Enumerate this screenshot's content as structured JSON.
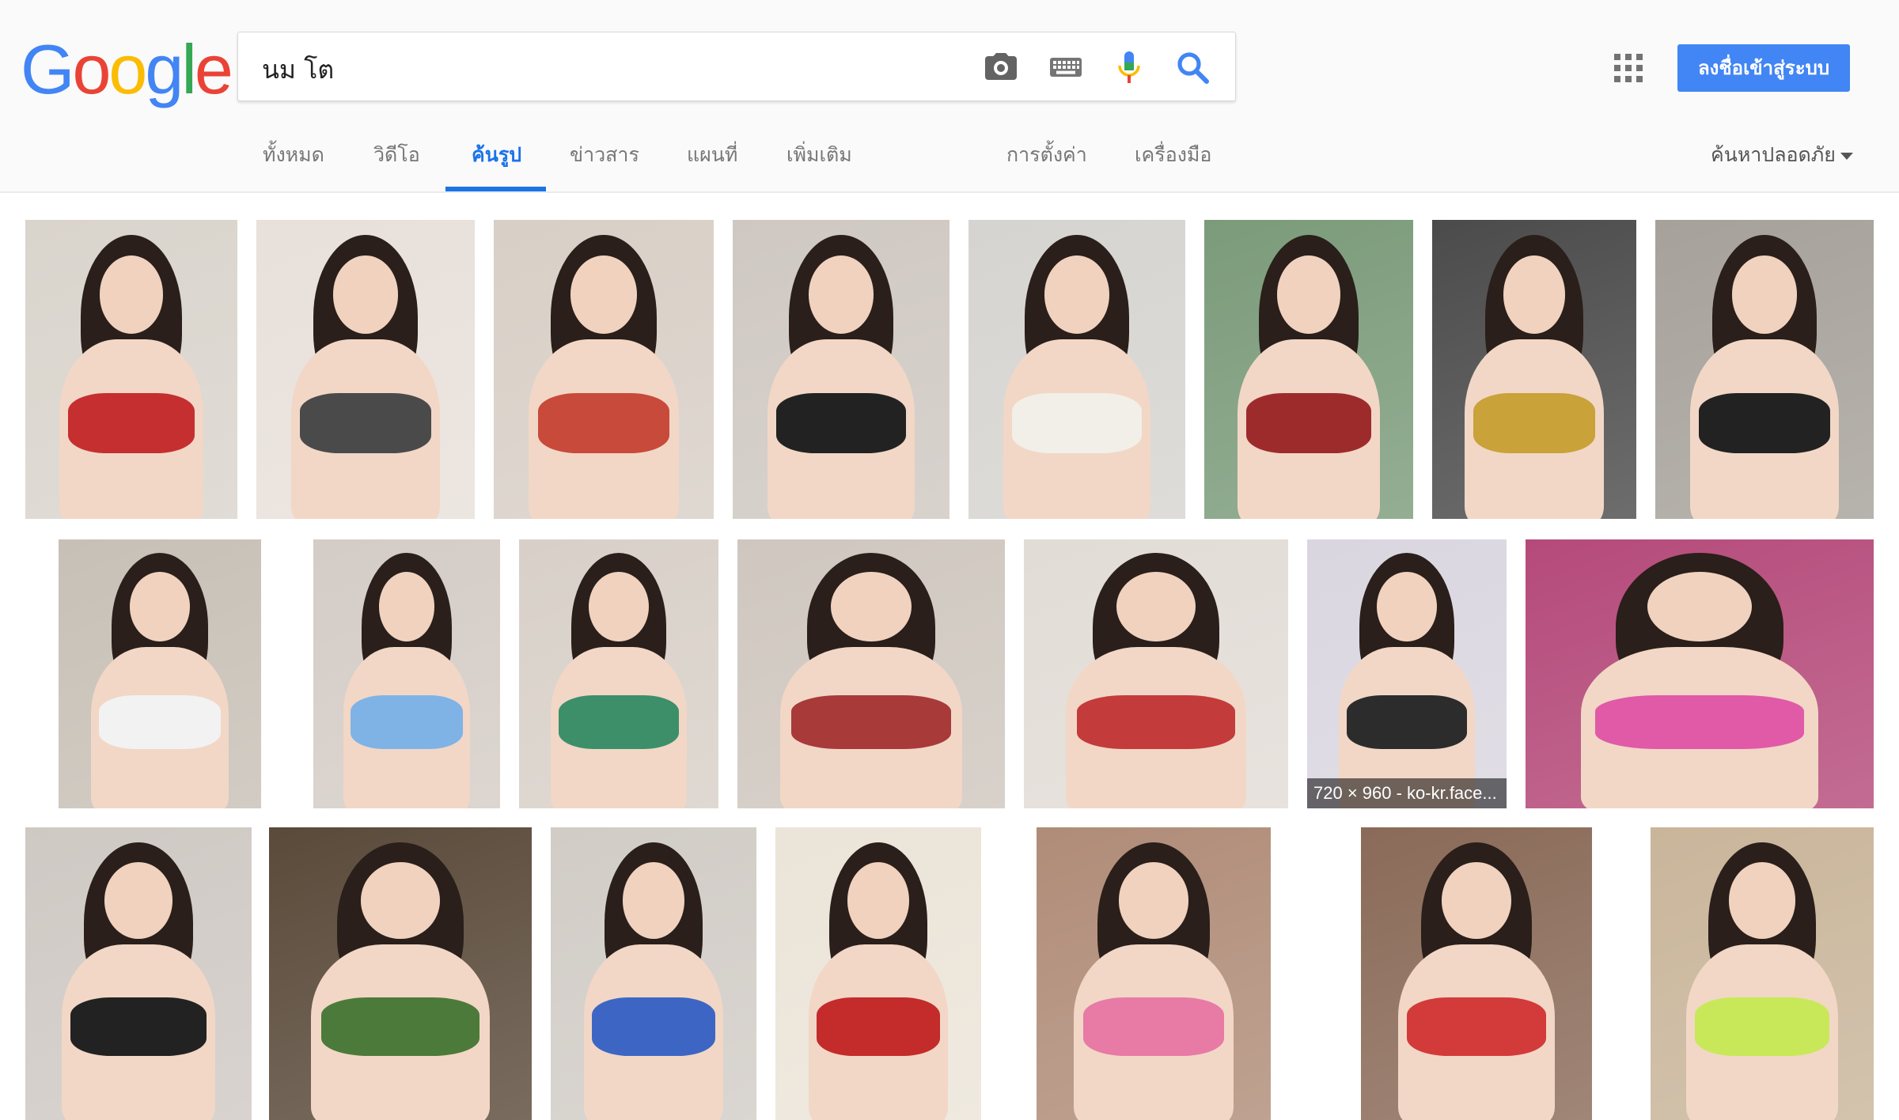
{
  "search": {
    "query": "นม โต"
  },
  "logo": {
    "letters": [
      "G",
      "o",
      "o",
      "g",
      "l",
      "e"
    ],
    "colors": [
      "#4285f4",
      "#ea4335",
      "#fbbc05",
      "#4285f4",
      "#34a853",
      "#ea4335"
    ]
  },
  "header": {
    "signin_label": "ลงชื่อเข้าสู่ระบบ",
    "safesearch_label": "ค้นหาปลอดภัย"
  },
  "tabs": [
    {
      "label": "ทั้งหมด",
      "active": false
    },
    {
      "label": "วิดีโอ",
      "active": false
    },
    {
      "label": "ค้นรูป",
      "active": true
    },
    {
      "label": "ข่าวสาร",
      "active": false
    },
    {
      "label": "แผนที่",
      "active": false
    },
    {
      "label": "เพิ่มเติม",
      "active": false
    },
    {
      "label": "การตั้งค่า",
      "active": false
    },
    {
      "label": "เครื่องมือ",
      "active": false
    }
  ],
  "colors": {
    "accent": "#1a73e8",
    "signin": "#4285f4",
    "header_bg": "#fafafa"
  },
  "results": {
    "hover_caption": "720 × 960 - ko-kr.face..."
  }
}
